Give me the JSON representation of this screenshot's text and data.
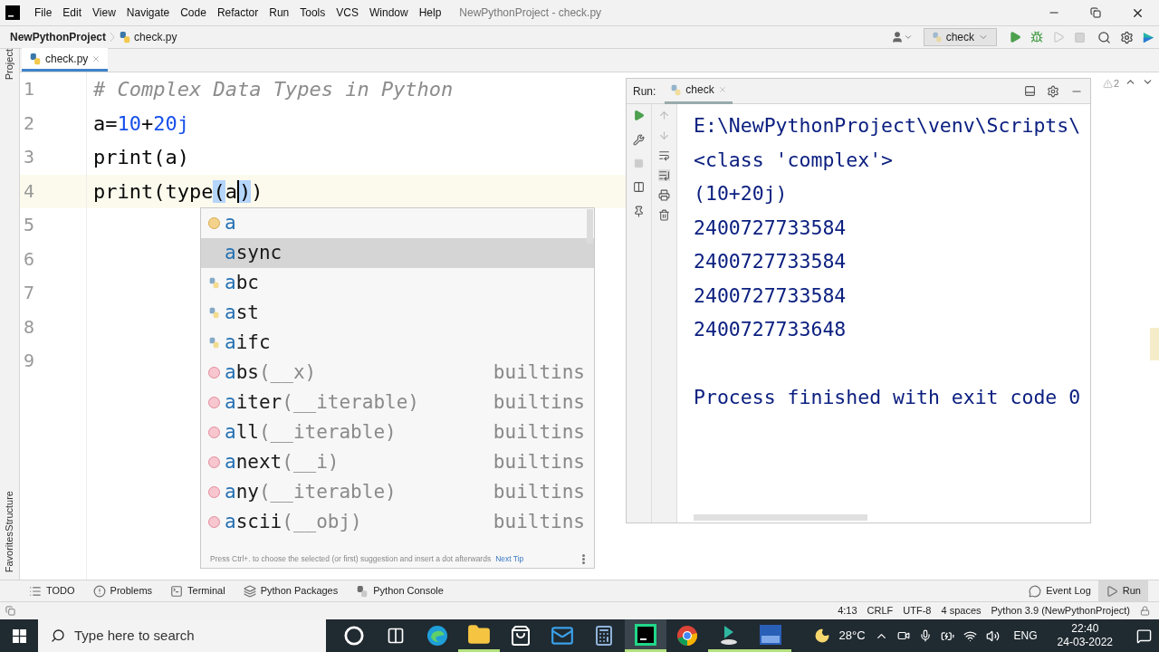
{
  "menu": [
    "File",
    "Edit",
    "View",
    "Navigate",
    "Code",
    "Refactor",
    "Run",
    "Tools",
    "VCS",
    "Window",
    "Help"
  ],
  "window": {
    "title": "NewPythonProject - check.py"
  },
  "breadcrumb": {
    "project": "NewPythonProject",
    "file": "check.py"
  },
  "run_config": {
    "label": "check"
  },
  "editor_tabs": [
    {
      "label": "check.py",
      "selected": true
    }
  ],
  "side_labels": {
    "top": "Project",
    "bottom": [
      "Structure",
      "Favorites"
    ]
  },
  "editor": {
    "warnings": "2",
    "rows": [
      {
        "number": "1",
        "current": false,
        "tokens": [
          {
            "text": "# Complex Data Types in Python",
            "kind": "comment"
          }
        ]
      },
      {
        "number": "2",
        "current": false,
        "tokens": [
          {
            "text": "a",
            "kind": "ident"
          },
          {
            "text": "=",
            "kind": "op"
          },
          {
            "text": "10",
            "kind": "number"
          },
          {
            "text": "+",
            "kind": "op"
          },
          {
            "text": "20j",
            "kind": "number"
          }
        ]
      },
      {
        "number": "3",
        "current": false,
        "tokens": [
          {
            "text": "print",
            "kind": "ident"
          },
          {
            "text": "(",
            "kind": "paren"
          },
          {
            "text": "a",
            "kind": "ident"
          },
          {
            "text": ")",
            "kind": "paren"
          }
        ]
      },
      {
        "number": "4",
        "current": true,
        "tokens": [
          {
            "text": "print",
            "kind": "ident"
          },
          {
            "text": "(",
            "kind": "paren"
          },
          {
            "text": "type",
            "kind": "ident"
          },
          {
            "text": "(",
            "kind": "paren-match"
          },
          {
            "text": "a",
            "kind": "ident",
            "caret": true
          },
          {
            "text": ")",
            "kind": "paren-match"
          },
          {
            "text": ")",
            "kind": "paren"
          }
        ]
      },
      {
        "number": "5",
        "current": false
      },
      {
        "number": "6",
        "current": false
      },
      {
        "number": "7",
        "current": false
      },
      {
        "number": "8",
        "current": false
      },
      {
        "number": "9",
        "current": false
      }
    ]
  },
  "completion": {
    "items": [
      {
        "kind": "variable",
        "prefix": "a",
        "selected": false
      },
      {
        "kind": "keyword",
        "prefix": "a",
        "rest": "sync",
        "selected": true
      },
      {
        "kind": "module",
        "prefix": "a",
        "rest": "bc",
        "selected": false
      },
      {
        "kind": "module",
        "prefix": "a",
        "rest": "st",
        "selected": false
      },
      {
        "kind": "module",
        "prefix": "a",
        "rest": "ifc",
        "selected": false
      },
      {
        "kind": "function",
        "prefix": "a",
        "rest": "bs",
        "params": "(__x)",
        "source": "builtins",
        "selected": false
      },
      {
        "kind": "function",
        "prefix": "a",
        "rest": "iter",
        "params": "(__iterable)",
        "source": "builtins",
        "selected": false
      },
      {
        "kind": "function",
        "prefix": "a",
        "rest": "ll",
        "params": "(__iterable)",
        "source": "builtins",
        "selected": false
      },
      {
        "kind": "function",
        "prefix": "a",
        "rest": "next",
        "params": "(__i)",
        "source": "builtins",
        "selected": false
      },
      {
        "kind": "function",
        "prefix": "a",
        "rest": "ny",
        "params": "(__iterable)",
        "source": "builtins",
        "selected": false
      },
      {
        "kind": "function",
        "prefix": "a",
        "rest": "scii",
        "params": "(__obj)",
        "source": "builtins",
        "selected": false
      }
    ],
    "hint": "Press Ctrl+. to choose the selected (or first) suggestion and insert a dot afterwards",
    "hint_link": "Next Tip"
  },
  "run_panel": {
    "label": "Run:",
    "tab": "check",
    "output": [
      {
        "text": "E:\\NewPythonProject\\venv\\Scripts\\",
        "kind": "output"
      },
      {
        "text": "<class 'complex'>",
        "kind": "output"
      },
      {
        "text": "(10+20j)",
        "kind": "output"
      },
      {
        "text": "2400727733584",
        "kind": "output"
      },
      {
        "text": "2400727733584",
        "kind": "output"
      },
      {
        "text": "2400727733584",
        "kind": "output"
      },
      {
        "text": "2400727733648",
        "kind": "output"
      },
      {
        "text": "Process finished with exit code 0",
        "kind": "status"
      }
    ]
  },
  "tool_tabs": [
    {
      "label": "TODO",
      "kind": "list",
      "selected": false
    },
    {
      "label": "Problems",
      "kind": "alert",
      "selected": false
    },
    {
      "label": "Terminal",
      "kind": "terminal",
      "selected": false
    },
    {
      "label": "Python Packages",
      "kind": "layers",
      "selected": false
    },
    {
      "label": "Python Console",
      "kind": "python",
      "selected": false
    }
  ],
  "tool_tabs_right": [
    {
      "label": "Event Log",
      "kind": "bubble",
      "selected": false
    },
    {
      "label": "Run",
      "kind": "play",
      "selected": true
    }
  ],
  "status_bar": [
    "4:13",
    "CRLF",
    "UTF-8",
    "4 spaces",
    "Python 3.9 (NewPythonProject)"
  ],
  "taskbar": {
    "search_placeholder": "Type here to search",
    "apps": [
      {
        "kind": "cortana",
        "running": false,
        "selected": false
      },
      {
        "kind": "taskview",
        "running": false,
        "selected": false
      },
      {
        "kind": "edge",
        "running": false,
        "selected": false
      },
      {
        "kind": "explorer",
        "running": true,
        "selected": false
      },
      {
        "kind": "store",
        "running": false,
        "selected": false
      },
      {
        "kind": "mail",
        "running": false,
        "selected": false
      },
      {
        "kind": "calculator",
        "running": false,
        "selected": false
      },
      {
        "kind": "pycharm",
        "running": true,
        "selected": true
      },
      {
        "kind": "chrome",
        "running": false,
        "selected": false
      },
      {
        "kind": "installer",
        "running": true,
        "selected": false
      },
      {
        "kind": "devcpp",
        "running": true,
        "selected": false
      }
    ],
    "temperature": "28°C",
    "language": "ENG",
    "time": "22:40",
    "date": "24-03-2022"
  }
}
